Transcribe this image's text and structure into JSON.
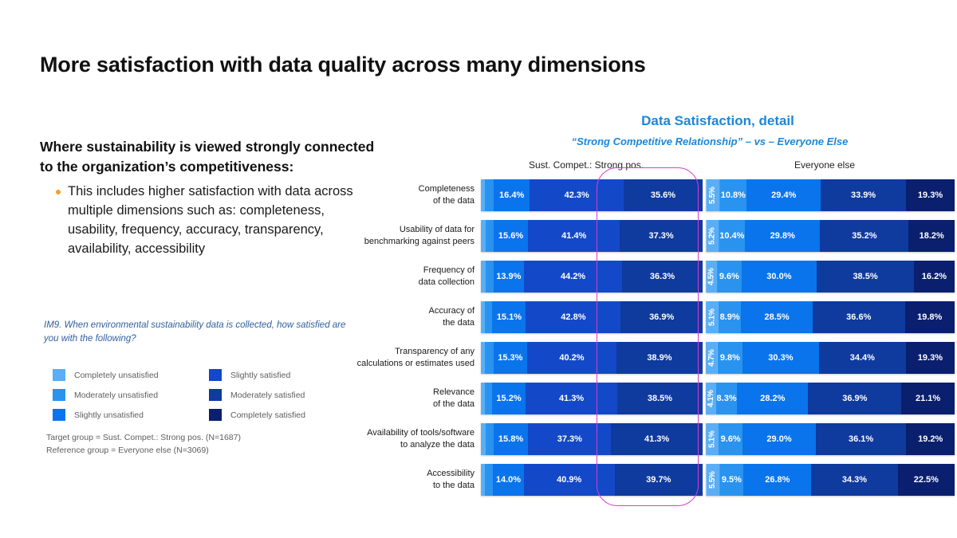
{
  "slide": {
    "title": "More satisfaction with data quality across many dimensions"
  },
  "left_panel": {
    "lead_heading": "Where sustainability is viewed strongly connected to the organization’s competitiveness:",
    "bullets": [
      "This includes higher satisfaction with data across multiple dimensions such as: completeness, usability, frequency, accuracy, transparency, availability, accessibility"
    ],
    "question_note": "IM9. When environmental sustainability data is collected, how satisfied are you with the following?",
    "group_note": "Target group = Sust. Compet.: Strong pos. (N=1687)\nReference group = Everyone else (N=3069)"
  },
  "legend": {
    "items": [
      {
        "label": "Completely unsatisfied",
        "color": "#5aaef5"
      },
      {
        "label": "Slightly satisfied",
        "color": "#1349c8"
      },
      {
        "label": "Moderately unsatisfied",
        "color": "#2a93f0"
      },
      {
        "label": "Moderately satisfied",
        "color": "#0f3a9e"
      },
      {
        "label": "Slightly unsatisfied",
        "color": "#0a74ec"
      },
      {
        "label": "Completely satisfied",
        "color": "#0a1f6e"
      }
    ]
  },
  "chart_header": {
    "title": "Data Satisfaction, detail",
    "subtitle": "“Strong Competitive Relationship” – vs – Everyone Else",
    "column_left": "Sust. Compet.: Strong pos.",
    "column_right": "Everyone else",
    "accent_color": "#1b87d8",
    "highlight_color": "#d43fd4"
  },
  "chart_data": {
    "type": "bar",
    "orientation": "horizontal",
    "stacked": true,
    "normalized_percent": true,
    "title": "Data Satisfaction, detail",
    "subtitle": "“Strong Competitive Relationship” – vs – Everyone Else",
    "xlabel": "",
    "ylabel": "",
    "xlim": [
      0,
      100
    ],
    "grid": false,
    "legend_position": "left-panel",
    "segment_names": [
      "Completely unsatisfied",
      "Moderately unsatisfied",
      "Slightly unsatisfied",
      "Slightly satisfied",
      "Moderately satisfied",
      "Completely satisfied"
    ],
    "segment_colors": [
      "#5aaef5",
      "#2a93f0",
      "#0a74ec",
      "#1349c8",
      "#0f3a9e",
      "#0a1f6e"
    ],
    "categories": [
      "Completeness\nof the data",
      "Usability of data for\nbenchmarking against peers",
      "Frequency of\ndata collection",
      "Accuracy of\nthe data",
      "Transparency of any\ncalculations or estimates used",
      "Relevance\nof the data",
      "Availability of tools/software\nto analyze the data",
      "Accessibility\nto the data"
    ],
    "groups": [
      {
        "name": "Sust. Compet.: Strong pos.",
        "n": 1687,
        "rows": [
          {
            "category": "Completeness of the data",
            "segments": [
              {
                "name": "Completely unsatisfied",
                "value": 1.9,
                "label": "",
                "color": "#5aaef5"
              },
              {
                "name": "Moderately unsatisfied",
                "value": 3.8,
                "label": "",
                "color": "#2a93f0"
              },
              {
                "name": "Slightly unsatisfied",
                "value": 16.4,
                "label": "16.4%",
                "color": "#0a74ec"
              },
              {
                "name": "Slightly satisfied",
                "value": 42.3,
                "label": "42.3%",
                "color": "#1349c8"
              },
              {
                "name": "Moderately satisfied",
                "value": 35.6,
                "label": "35.6%",
                "color": "#0f3a9e"
              }
            ]
          },
          {
            "category": "Usability of data for benchmarking against peers",
            "segments": [
              {
                "name": "Completely unsatisfied",
                "value": 2.0,
                "label": "",
                "color": "#5aaef5"
              },
              {
                "name": "Moderately unsatisfied",
                "value": 3.7,
                "label": "",
                "color": "#2a93f0"
              },
              {
                "name": "Slightly unsatisfied",
                "value": 15.6,
                "label": "15.6%",
                "color": "#0a74ec"
              },
              {
                "name": "Slightly satisfied",
                "value": 41.4,
                "label": "41.4%",
                "color": "#1349c8"
              },
              {
                "name": "Moderately satisfied",
                "value": 37.3,
                "label": "37.3%",
                "color": "#0f3a9e"
              }
            ]
          },
          {
            "category": "Frequency of data collection",
            "segments": [
              {
                "name": "Completely unsatisfied",
                "value": 2.0,
                "label": "",
                "color": "#5aaef5"
              },
              {
                "name": "Moderately unsatisfied",
                "value": 3.6,
                "label": "",
                "color": "#2a93f0"
              },
              {
                "name": "Slightly unsatisfied",
                "value": 13.9,
                "label": "13.9%",
                "color": "#0a74ec"
              },
              {
                "name": "Slightly satisfied",
                "value": 44.2,
                "label": "44.2%",
                "color": "#1349c8"
              },
              {
                "name": "Moderately satisfied",
                "value": 36.3,
                "label": "36.3%",
                "color": "#0f3a9e"
              }
            ]
          },
          {
            "category": "Accuracy of the data",
            "segments": [
              {
                "name": "Completely unsatisfied",
                "value": 1.8,
                "label": "",
                "color": "#5aaef5"
              },
              {
                "name": "Moderately unsatisfied",
                "value": 3.4,
                "label": "",
                "color": "#2a93f0"
              },
              {
                "name": "Slightly unsatisfied",
                "value": 15.1,
                "label": "15.1%",
                "color": "#0a74ec"
              },
              {
                "name": "Slightly satisfied",
                "value": 42.8,
                "label": "42.8%",
                "color": "#1349c8"
              },
              {
                "name": "Moderately satisfied",
                "value": 36.9,
                "label": "36.9%",
                "color": "#0f3a9e"
              }
            ]
          },
          {
            "category": "Transparency of any calculations or estimates used",
            "segments": [
              {
                "name": "Completely unsatisfied",
                "value": 1.9,
                "label": "",
                "color": "#5aaef5"
              },
              {
                "name": "Moderately unsatisfied",
                "value": 3.7,
                "label": "",
                "color": "#2a93f0"
              },
              {
                "name": "Slightly unsatisfied",
                "value": 15.3,
                "label": "15.3%",
                "color": "#0a74ec"
              },
              {
                "name": "Slightly satisfied",
                "value": 40.2,
                "label": "40.2%",
                "color": "#1349c8"
              },
              {
                "name": "Moderately satisfied",
                "value": 38.9,
                "label": "38.9%",
                "color": "#0f3a9e"
              }
            ]
          },
          {
            "category": "Relevance of the data",
            "segments": [
              {
                "name": "Completely unsatisfied",
                "value": 1.7,
                "label": "",
                "color": "#5aaef5"
              },
              {
                "name": "Moderately unsatisfied",
                "value": 3.3,
                "label": "",
                "color": "#2a93f0"
              },
              {
                "name": "Slightly unsatisfied",
                "value": 15.2,
                "label": "15.2%",
                "color": "#0a74ec"
              },
              {
                "name": "Slightly satisfied",
                "value": 41.3,
                "label": "41.3%",
                "color": "#1349c8"
              },
              {
                "name": "Moderately satisfied",
                "value": 38.5,
                "label": "38.5%",
                "color": "#0f3a9e"
              }
            ]
          },
          {
            "category": "Availability of tools/software to analyze the data",
            "segments": [
              {
                "name": "Completely unsatisfied",
                "value": 2.0,
                "label": "",
                "color": "#5aaef5"
              },
              {
                "name": "Moderately unsatisfied",
                "value": 3.6,
                "label": "",
                "color": "#2a93f0"
              },
              {
                "name": "Slightly unsatisfied",
                "value": 15.8,
                "label": "15.8%",
                "color": "#0a74ec"
              },
              {
                "name": "Slightly satisfied",
                "value": 37.3,
                "label": "37.3%",
                "color": "#1349c8"
              },
              {
                "name": "Moderately satisfied",
                "value": 41.3,
                "label": "41.3%",
                "color": "#0f3a9e"
              }
            ]
          },
          {
            "category": "Accessibility to the data",
            "segments": [
              {
                "name": "Completely unsatisfied",
                "value": 1.8,
                "label": "",
                "color": "#5aaef5"
              },
              {
                "name": "Moderately unsatisfied",
                "value": 3.6,
                "label": "",
                "color": "#2a93f0"
              },
              {
                "name": "Slightly unsatisfied",
                "value": 14.0,
                "label": "14.0%",
                "color": "#0a74ec"
              },
              {
                "name": "Slightly satisfied",
                "value": 40.9,
                "label": "40.9%",
                "color": "#1349c8"
              },
              {
                "name": "Moderately satisfied",
                "value": 39.7,
                "label": "39.7%",
                "color": "#0f3a9e"
              }
            ]
          }
        ]
      },
      {
        "name": "Everyone else",
        "n": 3069,
        "rows": [
          {
            "category": "Completeness of the data",
            "segments": [
              {
                "name": "Completely unsatisfied",
                "value": 5.5,
                "label": "5.5%",
                "color": "#5aaef5",
                "rotated": true
              },
              {
                "name": "Moderately unsatisfied",
                "value": 10.8,
                "label": "10.8%",
                "color": "#2a93f0"
              },
              {
                "name": "Slightly unsatisfied",
                "value": 29.4,
                "label": "29.4%",
                "color": "#0a74ec"
              },
              {
                "name": "Slightly satisfied",
                "value": 33.9,
                "label": "33.9%",
                "color": "#0f3a9e"
              },
              {
                "name": "Completely satisfied",
                "value": 19.3,
                "label": "19.3%",
                "color": "#0a1f6e"
              }
            ]
          },
          {
            "category": "Usability of data for benchmarking against peers",
            "segments": [
              {
                "name": "Completely unsatisfied",
                "value": 5.2,
                "label": "5.2%",
                "color": "#5aaef5",
                "rotated": true
              },
              {
                "name": "Moderately unsatisfied",
                "value": 10.4,
                "label": "10.4%",
                "color": "#2a93f0"
              },
              {
                "name": "Slightly unsatisfied",
                "value": 29.8,
                "label": "29.8%",
                "color": "#0a74ec"
              },
              {
                "name": "Slightly satisfied",
                "value": 35.2,
                "label": "35.2%",
                "color": "#0f3a9e"
              },
              {
                "name": "Completely satisfied",
                "value": 18.2,
                "label": "18.2%",
                "color": "#0a1f6e"
              }
            ]
          },
          {
            "category": "Frequency of data collection",
            "segments": [
              {
                "name": "Completely unsatisfied",
                "value": 4.5,
                "label": "4.5%",
                "color": "#5aaef5",
                "rotated": true
              },
              {
                "name": "Moderately unsatisfied",
                "value": 9.6,
                "label": "9.6%",
                "color": "#2a93f0"
              },
              {
                "name": "Slightly unsatisfied",
                "value": 30.0,
                "label": "30.0%",
                "color": "#0a74ec"
              },
              {
                "name": "Slightly satisfied",
                "value": 38.5,
                "label": "38.5%",
                "color": "#0f3a9e"
              },
              {
                "name": "Completely satisfied",
                "value": 16.2,
                "label": "16.2%",
                "color": "#0a1f6e"
              }
            ]
          },
          {
            "category": "Accuracy of the data",
            "segments": [
              {
                "name": "Completely unsatisfied",
                "value": 5.1,
                "label": "5.1%",
                "color": "#5aaef5",
                "rotated": true
              },
              {
                "name": "Moderately unsatisfied",
                "value": 8.9,
                "label": "8.9%",
                "color": "#2a93f0"
              },
              {
                "name": "Slightly unsatisfied",
                "value": 28.5,
                "label": "28.5%",
                "color": "#0a74ec"
              },
              {
                "name": "Slightly satisfied",
                "value": 36.6,
                "label": "36.6%",
                "color": "#0f3a9e"
              },
              {
                "name": "Completely satisfied",
                "value": 19.8,
                "label": "19.8%",
                "color": "#0a1f6e"
              }
            ]
          },
          {
            "category": "Transparency of any calculations or estimates used",
            "segments": [
              {
                "name": "Completely unsatisfied",
                "value": 4.7,
                "label": "4.7%",
                "color": "#5aaef5",
                "rotated": true
              },
              {
                "name": "Moderately unsatisfied",
                "value": 9.8,
                "label": "9.8%",
                "color": "#2a93f0"
              },
              {
                "name": "Slightly unsatisfied",
                "value": 30.3,
                "label": "30.3%",
                "color": "#0a74ec"
              },
              {
                "name": "Slightly satisfied",
                "value": 34.4,
                "label": "34.4%",
                "color": "#0f3a9e"
              },
              {
                "name": "Completely satisfied",
                "value": 19.3,
                "label": "19.3%",
                "color": "#0a1f6e"
              }
            ]
          },
          {
            "category": "Relevance of the data",
            "segments": [
              {
                "name": "Completely unsatisfied",
                "value": 4.1,
                "label": "4.1%",
                "color": "#5aaef5",
                "rotated": true
              },
              {
                "name": "Moderately unsatisfied",
                "value": 8.3,
                "label": "8.3%",
                "color": "#2a93f0"
              },
              {
                "name": "Slightly unsatisfied",
                "value": 28.2,
                "label": "28.2%",
                "color": "#0a74ec"
              },
              {
                "name": "Slightly satisfied",
                "value": 36.9,
                "label": "36.9%",
                "color": "#0f3a9e"
              },
              {
                "name": "Completely satisfied",
                "value": 21.1,
                "label": "21.1%",
                "color": "#0a1f6e"
              }
            ]
          },
          {
            "category": "Availability of tools/software to analyze the data",
            "segments": [
              {
                "name": "Completely unsatisfied",
                "value": 5.1,
                "label": "5.1%",
                "color": "#5aaef5",
                "rotated": true
              },
              {
                "name": "Moderately unsatisfied",
                "value": 9.6,
                "label": "9.6%",
                "color": "#2a93f0"
              },
              {
                "name": "Slightly unsatisfied",
                "value": 29.0,
                "label": "29.0%",
                "color": "#0a74ec"
              },
              {
                "name": "Slightly satisfied",
                "value": 36.1,
                "label": "36.1%",
                "color": "#0f3a9e"
              },
              {
                "name": "Completely satisfied",
                "value": 19.2,
                "label": "19.2%",
                "color": "#0a1f6e"
              }
            ]
          },
          {
            "category": "Accessibility to the data",
            "segments": [
              {
                "name": "Completely unsatisfied",
                "value": 5.5,
                "label": "5.5%",
                "color": "#5aaef5",
                "rotated": true
              },
              {
                "name": "Moderately unsatisfied",
                "value": 9.5,
                "label": "9.5%",
                "color": "#2a93f0"
              },
              {
                "name": "Slightly unsatisfied",
                "value": 26.8,
                "label": "26.8%",
                "color": "#0a74ec"
              },
              {
                "name": "Slightly satisfied",
                "value": 34.3,
                "label": "34.3%",
                "color": "#0f3a9e"
              },
              {
                "name": "Completely satisfied",
                "value": 22.5,
                "label": "22.5%",
                "color": "#0a1f6e"
              }
            ]
          }
        ]
      }
    ]
  }
}
